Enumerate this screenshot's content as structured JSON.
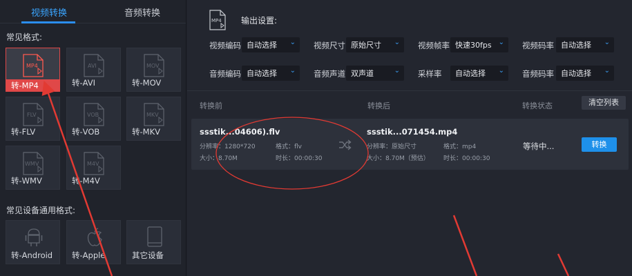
{
  "tabs": {
    "video": "视频转换",
    "audio": "音频转换"
  },
  "left": {
    "common_formats_title": "常见格式:",
    "formats": [
      {
        "badge": "MP4",
        "label": "转-MP4"
      },
      {
        "badge": "AVI",
        "label": "转-AVI"
      },
      {
        "badge": "MOV",
        "label": "转-MOV"
      },
      {
        "badge": "FLV",
        "label": "转-FLV"
      },
      {
        "badge": "VOB",
        "label": "转-VOB"
      },
      {
        "badge": "MKV",
        "label": "转-MKV"
      },
      {
        "badge": "WMV",
        "label": "转-WMV"
      },
      {
        "badge": "M4V",
        "label": "转-M4V"
      }
    ],
    "devices_title": "常见设备通用格式:",
    "devices": [
      {
        "label": "转-Android"
      },
      {
        "label": "转-Apple"
      },
      {
        "label": "其它设备"
      }
    ]
  },
  "output": {
    "badge": "MP4",
    "title": "输出设置:",
    "settings": {
      "video_codec": {
        "label": "视频编码",
        "value": "自动选择"
      },
      "video_size": {
        "label": "视频尺寸",
        "value": "原始尺寸"
      },
      "frame_rate": {
        "label": "视频帧率",
        "value": "快速30fps"
      },
      "video_bitrate": {
        "label": "视频码率",
        "value": "自动选择"
      },
      "audio_codec": {
        "label": "音频编码",
        "value": "自动选择"
      },
      "audio_channel": {
        "label": "音频声道",
        "value": "双声道"
      },
      "sample_rate": {
        "label": "采样率",
        "value": "自动选择"
      },
      "audio_bitrate": {
        "label": "音频码率",
        "value": "自动选择"
      }
    }
  },
  "list": {
    "before_header": "转换前",
    "after_header": "转换后",
    "status_header": "转换状态",
    "clear_label": "清空列表",
    "row": {
      "src_name": "ssstik...04606).flv",
      "src_res": "分辨率：1280*720",
      "src_fmt": "格式：flv",
      "src_size": "大小：8.70M",
      "src_dur": "时长：00:00:30",
      "dst_name": "ssstik...071454.mp4",
      "dst_res": "分辨率：原始尺寸",
      "dst_fmt": "格式：mp4",
      "dst_size": "大小：8.70M（预估）",
      "dst_dur": "时长：00:00:30",
      "status": "等待中...",
      "convert_label": "转换"
    }
  },
  "colors": {
    "accent": "#1e90ea",
    "active_tab": "#3aa5ff",
    "annotation_red": "#e23a33"
  }
}
